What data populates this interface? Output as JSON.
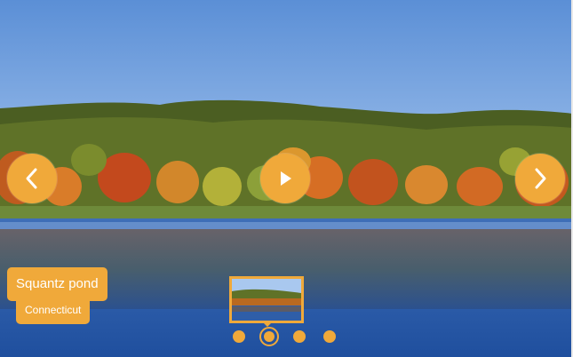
{
  "theme": {
    "accent": "#f0a93a"
  },
  "slide": {
    "title": "Squantz pond",
    "subtitle": "Connecticut"
  },
  "controls": {
    "prev_icon": "chevron-left-icon",
    "next_icon": "chevron-right-icon",
    "play_icon": "play-icon"
  },
  "pagination": {
    "count": 4,
    "active_index": 1
  }
}
